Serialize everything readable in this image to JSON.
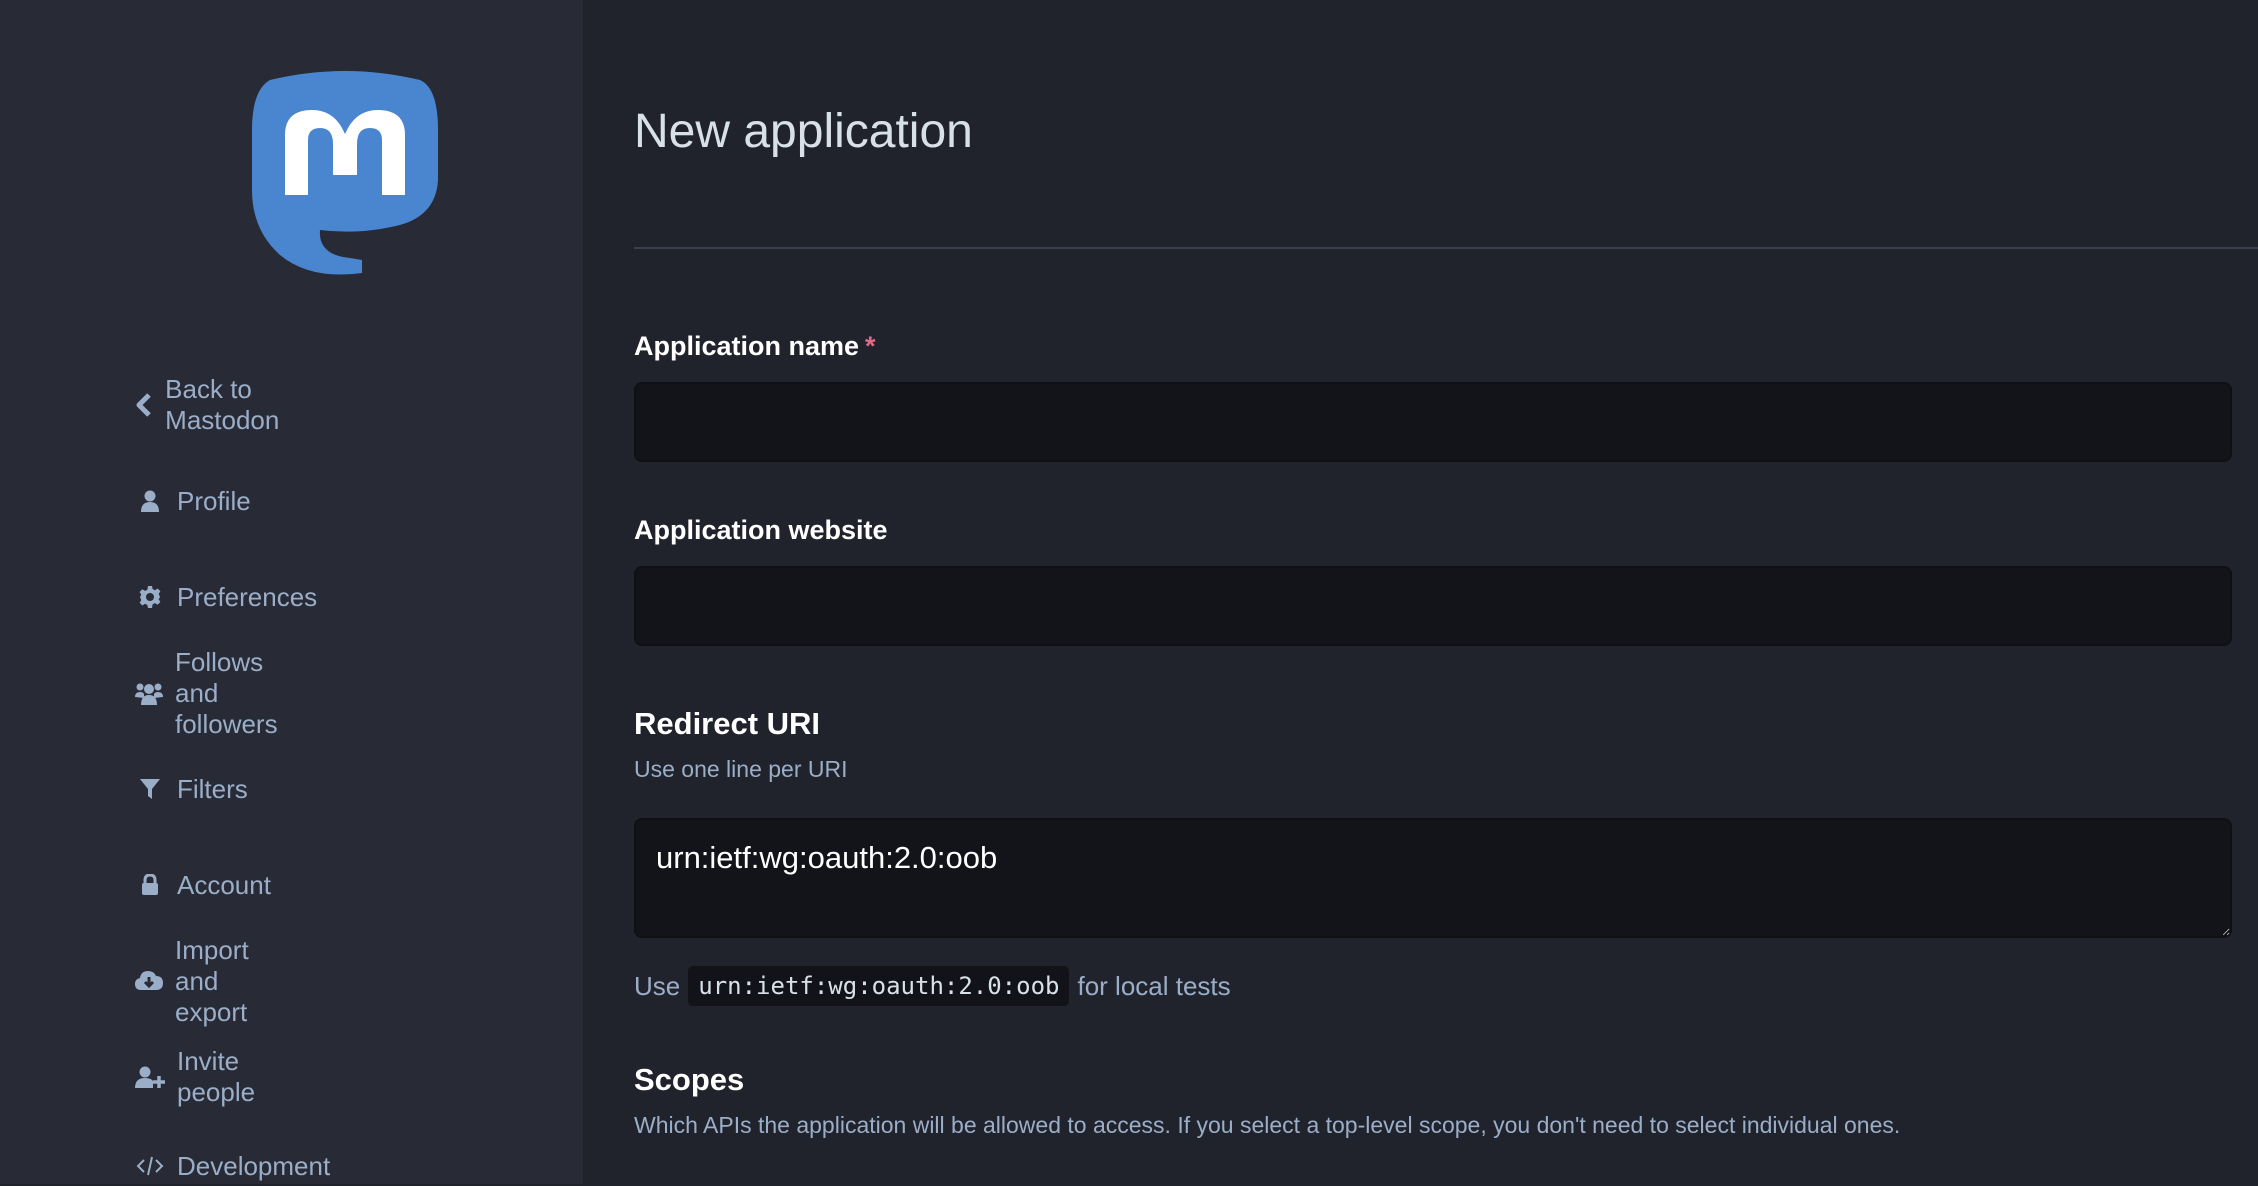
{
  "sidebar": {
    "logo": "mastodon-logo",
    "items": [
      {
        "label": "Back to Mastodon",
        "icon": "chevron-left-icon"
      },
      {
        "label": "Profile",
        "icon": "user-icon"
      },
      {
        "label": "Preferences",
        "icon": "gear-icon"
      },
      {
        "label": "Follows and followers",
        "icon": "users-icon"
      },
      {
        "label": "Filters",
        "icon": "filter-icon"
      },
      {
        "label": "Account",
        "icon": "lock-icon"
      },
      {
        "label": "Import and export",
        "icon": "cloud-download-icon"
      },
      {
        "label": "Invite people",
        "icon": "user-plus-icon"
      },
      {
        "label": "Development",
        "icon": "code-icon"
      }
    ]
  },
  "main": {
    "title": "New application",
    "fields": {
      "app_name": {
        "label": "Application name",
        "required_marker": "*",
        "value": ""
      },
      "app_website": {
        "label": "Application website",
        "value": ""
      },
      "redirect_uri": {
        "label": "Redirect URI",
        "hint": "Use one line per URI",
        "value": "urn:ietf:wg:oauth:2.0:oob",
        "help_prefix": "Use",
        "help_code": "urn:ietf:wg:oauth:2.0:oob",
        "help_suffix": "for local tests"
      }
    },
    "scopes": {
      "title": "Scopes",
      "hint": "Which APIs the application will be allowed to access. If you select a top-level scope, you don't need to select individual ones."
    }
  },
  "colors": {
    "brand": "#4a86cf",
    "sidebar_bg": "#282a36",
    "main_bg": "#21232c",
    "muted_text": "#9baec8",
    "required": "#e06c87"
  }
}
